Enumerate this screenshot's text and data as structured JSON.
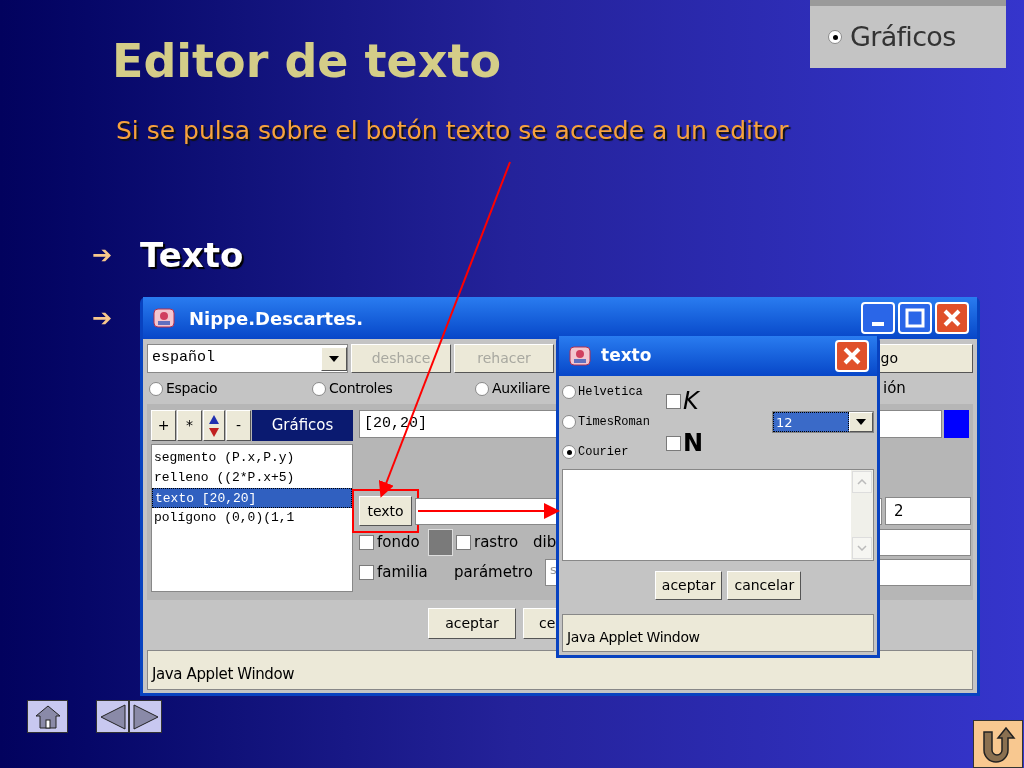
{
  "slide": {
    "title": "Editor de texto",
    "subtitle": "Si se pulsa sobre el botón texto se accede a un editor",
    "bullets": [
      {
        "marker": "➔",
        "text": "Texto"
      },
      {
        "marker": "➔"
      }
    ],
    "inset": {
      "label": "Gráficos",
      "selected": true
    }
  },
  "main_window": {
    "title": "Nippe.Descartes.",
    "language": "español",
    "toolbar_buttons": [
      {
        "label": "deshace",
        "disabled": true
      },
      {
        "label": "rehacer",
        "disabled": true
      },
      {
        "label": "go",
        "disabled": false
      }
    ],
    "radios": [
      {
        "label": "Espacio",
        "selected": false
      },
      {
        "label": "Controles",
        "selected": false
      },
      {
        "label": "Auxiliare",
        "selected": false
      }
    ],
    "radio_fragment": "ión",
    "panel_buttons": [
      "+",
      "*",
      "-"
    ],
    "panel_tab": {
      "label": "Gráficos",
      "selected": true
    },
    "items": [
      {
        "label": "segmento (P.x,P.y)",
        "selected": false
      },
      {
        "label": "relleno ((2*P.x+5)",
        "selected": false
      },
      {
        "label": "texto [20,20]",
        "selected": true
      },
      {
        "label": "polígono (0,0)(1,1",
        "selected": false
      }
    ],
    "position_field": "[20,20]",
    "texto_button": "texto",
    "size_field": "2",
    "checks": [
      {
        "label": "fondo",
        "checked": false
      },
      {
        "label": "rastro",
        "checked": false
      },
      {
        "label": "familia",
        "checked": false
      }
    ],
    "dib_label": "dib",
    "parameter_label": "parámetro",
    "parameter_field": "s",
    "bottom_buttons": [
      "aceptar",
      "ce"
    ],
    "status": "Java Applet Window"
  },
  "dialog": {
    "title": "texto",
    "fonts": [
      {
        "label": "Helvetica",
        "selected": false
      },
      {
        "label": "TimesRoman",
        "selected": false
      },
      {
        "label": "Courier",
        "selected": true
      }
    ],
    "styles": [
      {
        "label": "K",
        "kind": "italic",
        "checked": false
      },
      {
        "label": "N",
        "kind": "bold",
        "checked": false
      }
    ],
    "size": "12",
    "buttons": [
      "aceptar",
      "cancelar"
    ],
    "status": "Java Applet Window"
  }
}
